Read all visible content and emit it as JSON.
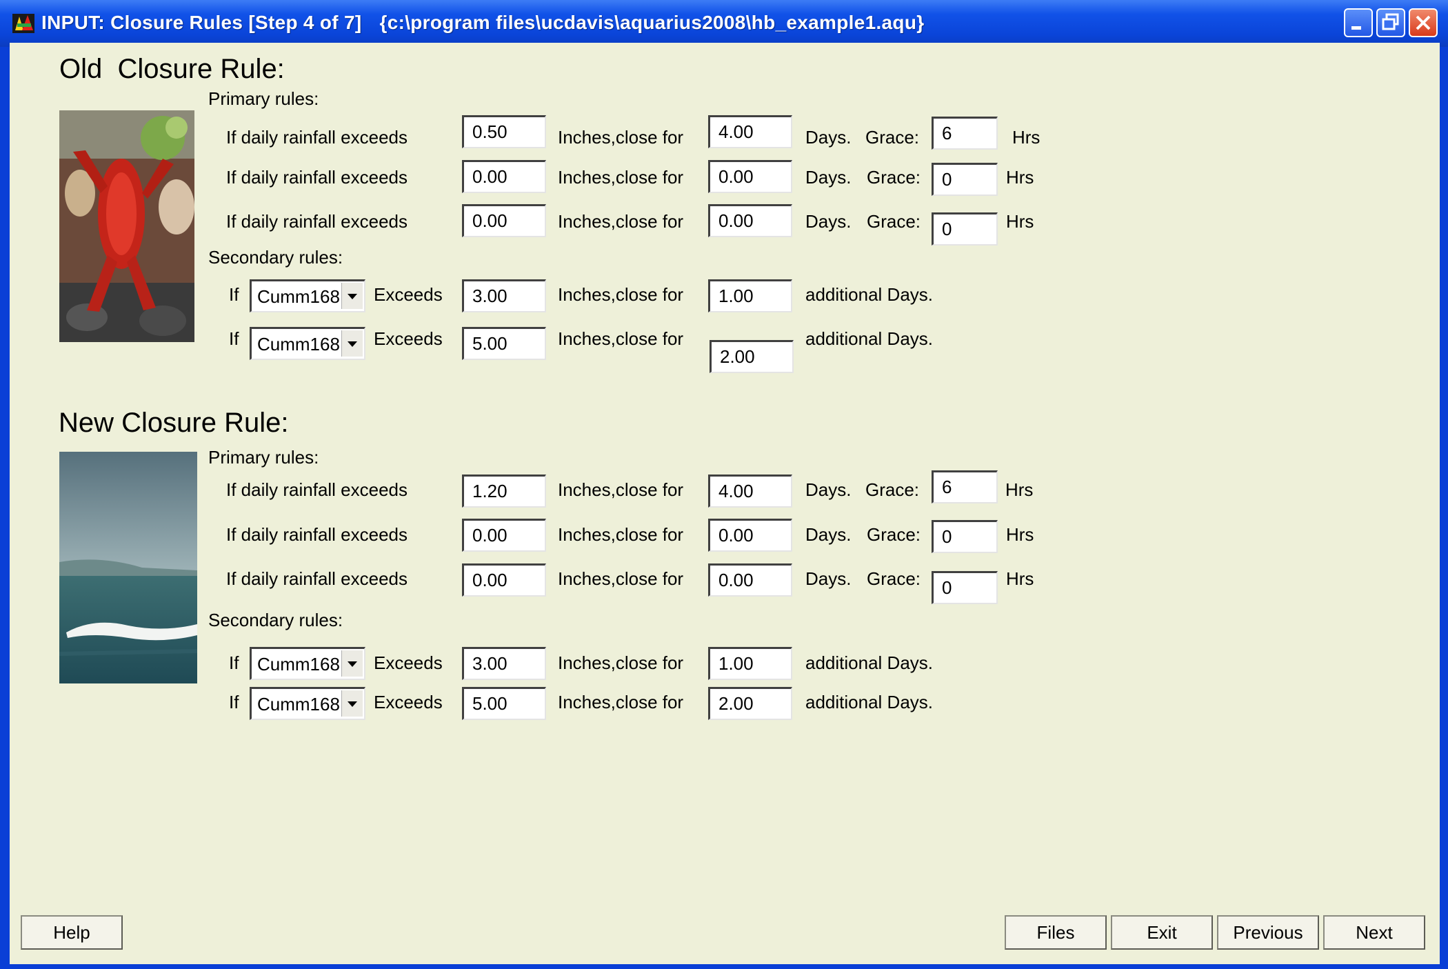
{
  "window": {
    "title": "INPUT: Closure Rules [Step 4 of 7]",
    "file_path": "{c:\\program files\\ucdavis\\aquarius2008\\hb_example1.aqu}"
  },
  "labels": {
    "primary_rules": "Primary rules:",
    "secondary_rules": "Secondary rules:",
    "if_daily_rainfall": "If daily rainfall exceeds",
    "inches_close_for": "Inches,close for",
    "days": "Days.",
    "grace": "Grace:",
    "hrs": "Hrs",
    "if": "If",
    "exceeds": "Exceeds",
    "additional_days": "additional Days."
  },
  "old_rule": {
    "heading": "Old  Closure Rule:",
    "primary": [
      {
        "rainfall": "0.50",
        "days": "4.00",
        "grace": "6"
      },
      {
        "rainfall": "0.00",
        "days": "0.00",
        "grace": "0"
      },
      {
        "rainfall": "0.00",
        "days": "0.00",
        "grace": "0"
      }
    ],
    "secondary": [
      {
        "variable": "Cumm168",
        "exceeds": "3.00",
        "days": "1.00"
      },
      {
        "variable": "Cumm168",
        "exceeds": "5.00",
        "days": "2.00"
      }
    ]
  },
  "new_rule": {
    "heading": "New Closure Rule:",
    "primary": [
      {
        "rainfall": "1.20",
        "days": "4.00",
        "grace": "6"
      },
      {
        "rainfall": "0.00",
        "days": "0.00",
        "grace": "0"
      },
      {
        "rainfall": "0.00",
        "days": "0.00",
        "grace": "0"
      }
    ],
    "secondary": [
      {
        "variable": "Cumm168",
        "exceeds": "3.00",
        "days": "1.00"
      },
      {
        "variable": "Cumm168",
        "exceeds": "5.00",
        "days": "2.00"
      }
    ]
  },
  "buttons": {
    "help": "Help",
    "files": "Files",
    "exit": "Exit",
    "previous": "Previous",
    "next": "Next"
  },
  "icons": {
    "app": "aquarius-app-icon",
    "minimize": "minimize-icon",
    "maximize": "restore-icon",
    "close": "close-icon",
    "dropdown": "chevron-down-icon"
  },
  "colors": {
    "titlebar": "#0a44d8",
    "client_bg": "#eef0d9",
    "close_button": "#d93a1b"
  }
}
